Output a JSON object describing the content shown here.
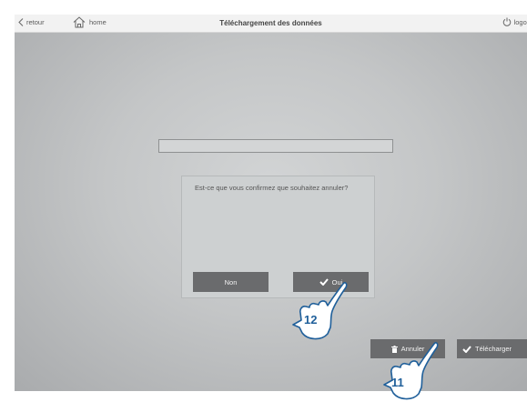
{
  "topbar": {
    "back_label": "retour",
    "home_label": "home",
    "title": "Téléchargement des données",
    "logout_label": "logout"
  },
  "dialog": {
    "message": "Est-ce que vous confirmez que souhaitez annuler?",
    "no_label": "Non",
    "yes_label": "Oui"
  },
  "actions": {
    "cancel_label": "Annuler",
    "download_label": "Télécharger"
  },
  "callouts": {
    "yes_step": "12",
    "cancel_step": "11"
  },
  "icons": [
    "chevron-left-icon",
    "home-icon",
    "power-icon",
    "check-icon",
    "trash-icon",
    "pointing-hand-icon"
  ],
  "colors": {
    "button_bg": "#6a6b6d",
    "callout_blue": "#1f5f9a"
  }
}
